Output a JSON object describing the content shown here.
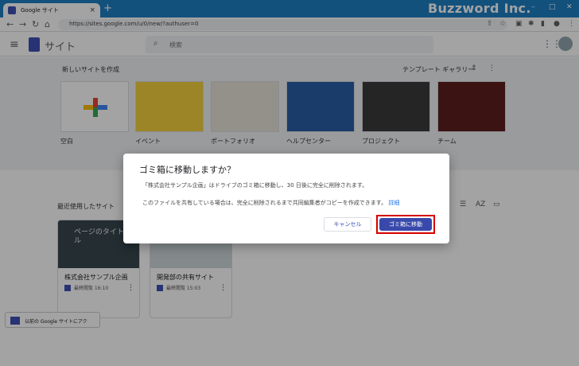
{
  "browser": {
    "tab_title": "Google サイト",
    "tab_close": "×",
    "new_tab": "+",
    "url": "https://sites.google.com/u/0/new/?authuser=0",
    "brand_watermark": "Buzzword Inc."
  },
  "app": {
    "title": "サイト",
    "search_placeholder": "検索"
  },
  "new_site": {
    "heading": "新しいサイトを作成",
    "gallery_label": "テンプレート ギャラリー",
    "templates": [
      {
        "label": "空白"
      },
      {
        "label": "イベント"
      },
      {
        "label": "ポートフォリオ"
      },
      {
        "label": "ヘルプセンター"
      },
      {
        "label": "プロジェクト"
      },
      {
        "label": "チーム"
      }
    ]
  },
  "recent": {
    "heading": "最近使用したサイト",
    "cards": [
      {
        "thumb_title": "ページのタイトル",
        "title": "株式会社サンプル企画",
        "meta": "最終閲覧 16:10"
      },
      {
        "thumb_title": "",
        "title": "開発部の共有サイト",
        "meta": "最終閲覧 15:03"
      }
    ]
  },
  "old_sites": "以前の Google サイトにアク",
  "dialog": {
    "title": "ゴミ箱に移動しますか？",
    "body1": "「株式会社サンプル企画」はドライブのゴミ箱に移動し、30 日後に完全に削除されます。",
    "body2": "このファイルを共有している場合は、完全に削除されるまで共同編集者がコピーを作成できます。",
    "link": "詳細",
    "cancel": "キャンセル",
    "confirm": "ゴミ箱に移動"
  }
}
